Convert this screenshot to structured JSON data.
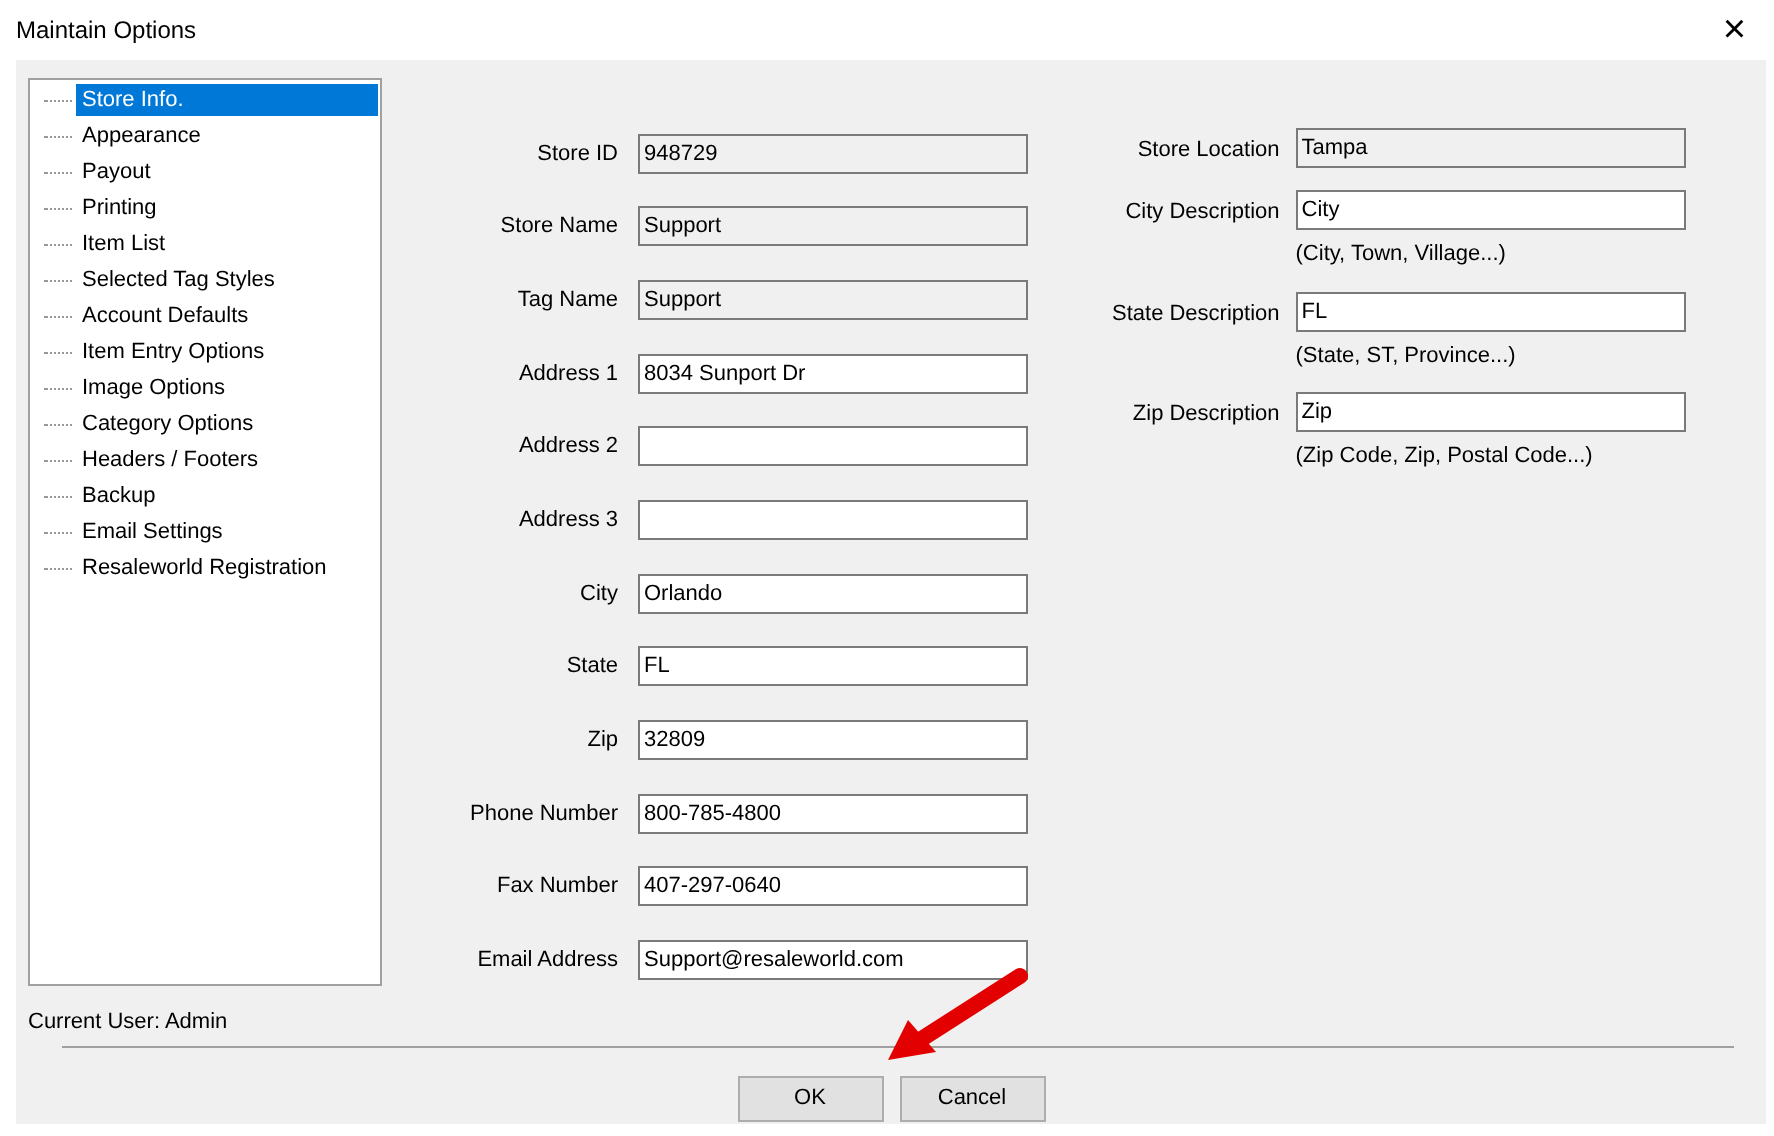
{
  "window": {
    "title": "Maintain Options",
    "close": "×"
  },
  "sidebar": {
    "items": [
      {
        "label": "Store Info.",
        "selected": true
      },
      {
        "label": "Appearance",
        "selected": false
      },
      {
        "label": "Payout",
        "selected": false
      },
      {
        "label": "Printing",
        "selected": false
      },
      {
        "label": "Item List",
        "selected": false
      },
      {
        "label": "Selected Tag Styles",
        "selected": false
      },
      {
        "label": "Account Defaults",
        "selected": false
      },
      {
        "label": "Item Entry Options",
        "selected": false
      },
      {
        "label": "Image Options",
        "selected": false
      },
      {
        "label": "Category Options",
        "selected": false
      },
      {
        "label": "Headers / Footers",
        "selected": false
      },
      {
        "label": "Backup",
        "selected": false
      },
      {
        "label": "Email Settings",
        "selected": false
      },
      {
        "label": "Resaleworld Registration",
        "selected": false
      }
    ]
  },
  "left_fields": [
    {
      "label": "Store ID",
      "value": "948729",
      "readonly": true
    },
    {
      "label": "Store Name",
      "value": "Support",
      "readonly": true
    },
    {
      "label": "Tag Name",
      "value": "Support",
      "readonly": true
    },
    {
      "label": "Address 1",
      "value": "8034 Sunport Dr",
      "readonly": false
    },
    {
      "label": "Address 2",
      "readonly": false
    },
    {
      "label": "Address 3",
      "readonly": false
    },
    {
      "label": "City",
      "value": "Orlando",
      "readonly": false
    },
    {
      "label": "State",
      "value": "FL",
      "readonly": false
    },
    {
      "label": "Zip",
      "value": "32809",
      "readonly": false
    },
    {
      "label": "Phone Number",
      "value": "800-785-4800",
      "readonly": false
    },
    {
      "label": "Fax Number",
      "value": "407-297-0640",
      "readonly": false
    },
    {
      "label": "Email Address",
      "value": "Support@resaleworld.com",
      "readonly": false
    }
  ],
  "right_fields": [
    {
      "label": "Store Location",
      "value": "Tampa",
      "readonly": true
    },
    {
      "label": "City Description",
      "value": "City",
      "readonly": false,
      "hint": "(City, Town, Village...)"
    },
    {
      "label": "State Description",
      "value": "FL",
      "readonly": false,
      "hint": "(State, ST, Province...)"
    },
    {
      "label": "Zip Description",
      "value": "Zip",
      "readonly": false,
      "hint": "(Zip Code, Zip, Postal Code...)"
    }
  ],
  "status": "Current User: Admin",
  "buttons": [
    "OK",
    "Cancel"
  ]
}
